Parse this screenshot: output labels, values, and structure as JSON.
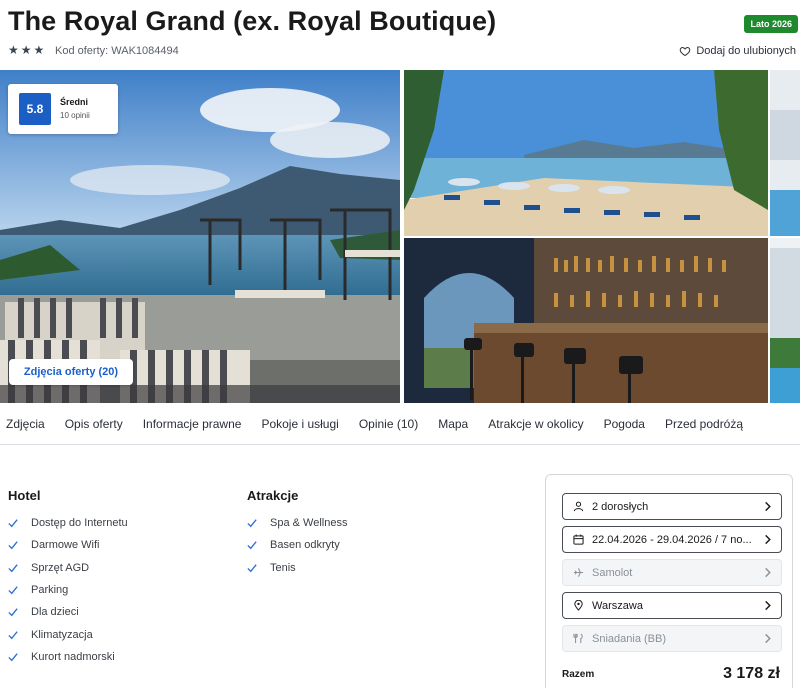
{
  "header": {
    "title": "The Royal Grand (ex. Royal Boutique)",
    "season_badge": "Lato 2026",
    "stars": 3,
    "offer_code": "Kod oferty: WAK1084494",
    "favorite_label": "Dodaj do ulubionych"
  },
  "gallery": {
    "rating_score": "5.8",
    "rating_label": "Średni",
    "rating_count": "10 opinii",
    "photos_button": "Zdjęcia oferty (20)"
  },
  "nav": {
    "items": [
      "Zdjęcia",
      "Opis oferty",
      "Informacje prawne",
      "Pokoje i usługi",
      "Opinie (10)",
      "Mapa",
      "Atrakcje w okolicy",
      "Pogoda",
      "Przed podróżą"
    ]
  },
  "features": {
    "hotel_title": "Hotel",
    "hotel_items": [
      "Dostęp do Internetu",
      "Darmowe Wifi",
      "Sprzęt AGD",
      "Parking",
      "Dla dzieci",
      "Klimatyzacja",
      "Kurort nadmorski"
    ],
    "attractions_title": "Atrakcje",
    "attractions_items": [
      "Spa & Wellness",
      "Basen odkryty",
      "Tenis"
    ]
  },
  "booking": {
    "travelers": "2 dorosłych",
    "dates": "22.04.2026 - 29.04.2026 / 7 no...",
    "transport": "Samolot",
    "departure": "Warszawa",
    "board": "Śniadania (BB)",
    "total_label": "Razem",
    "total_value": "3 178 zł"
  },
  "colors": {
    "accent": "#1b5fc5",
    "season_badge": "#1f8a2d",
    "check": "#2f6fd6"
  },
  "icons": [
    "star-icon",
    "heart-icon",
    "check-icon",
    "user-icon",
    "calendar-icon",
    "plane-icon",
    "location-pin-icon",
    "cutlery-icon",
    "chevron-right-icon"
  ]
}
